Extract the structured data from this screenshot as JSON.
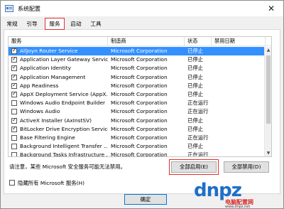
{
  "window": {
    "title": "系统配置",
    "close_glyph": "✕"
  },
  "tabs": [
    {
      "label": "常规"
    },
    {
      "label": "引导"
    },
    {
      "label": "服务",
      "active": true
    },
    {
      "label": "启动"
    },
    {
      "label": "工具"
    }
  ],
  "columns": {
    "service": "服务",
    "manufacturer": "制造商",
    "status": "状态",
    "disabled_date": "禁用日期"
  },
  "services": [
    {
      "name": "AllJoyn Router Service",
      "manufacturer": "Microsoft Corporation",
      "status": "已停止",
      "checked": true,
      "selected": true
    },
    {
      "name": "Application Layer Gateway Service",
      "manufacturer": "Microsoft Corporation",
      "status": "已停止",
      "checked": true
    },
    {
      "name": "Application Identity",
      "manufacturer": "Microsoft Corporation",
      "status": "已停止",
      "checked": true
    },
    {
      "name": "Application Management",
      "manufacturer": "Microsoft Corporation",
      "status": "已停止",
      "checked": true
    },
    {
      "name": "App Readiness",
      "manufacturer": "Microsoft Corporation",
      "status": "已停止",
      "checked": true
    },
    {
      "name": "AppX Deployment Service (AppX...",
      "manufacturer": "Microsoft Corporation",
      "status": "已停止",
      "checked": true
    },
    {
      "name": "Windows Audio Endpoint Builder",
      "manufacturer": "Microsoft Corporation",
      "status": "正在运行",
      "checked": false
    },
    {
      "name": "Windows Audio",
      "manufacturer": "Microsoft Corporation",
      "status": "正在运行",
      "checked": false
    },
    {
      "name": "ActiveX Installer (AxInstSV)",
      "manufacturer": "Microsoft Corporation",
      "status": "已停止",
      "checked": true
    },
    {
      "name": "BitLocker Drive Encryption Service",
      "manufacturer": "Microsoft Corporation",
      "status": "已停止",
      "checked": true
    },
    {
      "name": "Base Filtering Engine",
      "manufacturer": "Microsoft Corporation",
      "status": "正在运行",
      "checked": false
    },
    {
      "name": "Background Intelligent Transfer ...",
      "manufacturer": "Microsoft Corporation",
      "status": "已停止",
      "checked": false
    },
    {
      "name": "Background Tasks Infrastructure ...",
      "manufacturer": "Microsoft Corporation",
      "status": "正在运行",
      "checked": false
    }
  ],
  "note": "请注意，某些 Microsoft 安全服务可能无法禁用。",
  "buttons": {
    "enable_all": "全部启用(E)",
    "disable_all": "全部禁用(D)",
    "ok": "确定"
  },
  "hide_ms": {
    "label": "隐藏所有 Microsoft 服务(H)",
    "checked": false
  },
  "watermark": {
    "brand": "dnpz",
    "site_name": "电脑配置网",
    "url": "www.dnpz.net"
  },
  "colors": {
    "accent": "#3390ff",
    "highlight_box": "#e52d2d",
    "watermark_blue": "#1e6fc8",
    "watermark_red": "#d62828"
  }
}
